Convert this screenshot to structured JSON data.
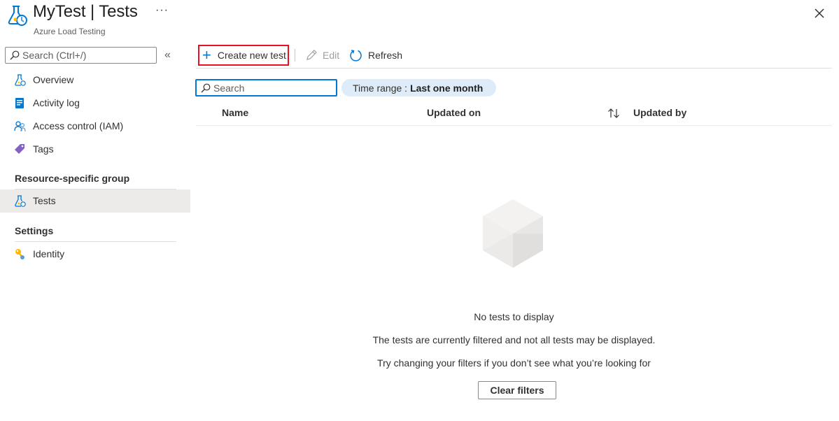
{
  "header": {
    "title": "MyTest | Tests",
    "subtitle": "Azure Load Testing",
    "more_label": "···",
    "app_icon": "load-testing-flask-icon",
    "close_icon": "close-icon"
  },
  "sidebar": {
    "search_placeholder": "Search (Ctrl+/)",
    "collapse_label": "«",
    "items": [
      {
        "label": "Overview",
        "icon": "flask-icon"
      },
      {
        "label": "Activity log",
        "icon": "activity-log-icon"
      },
      {
        "label": "Access control (IAM)",
        "icon": "people-icon"
      },
      {
        "label": "Tags",
        "icon": "tag-icon"
      }
    ],
    "groups": [
      {
        "label": "Resource-specific group",
        "items": [
          {
            "label": "Tests",
            "icon": "flask-icon",
            "selected": true
          }
        ]
      },
      {
        "label": "Settings",
        "items": [
          {
            "label": "Identity",
            "icon": "key-icon"
          }
        ]
      }
    ]
  },
  "toolbar": {
    "create_label": "Create new test",
    "edit_label": "Edit",
    "refresh_label": "Refresh"
  },
  "filters": {
    "search_placeholder": "Search",
    "time_range_key": "Time range :",
    "time_range_value": "Last one month"
  },
  "table": {
    "columns": [
      "Name",
      "Updated on",
      "Updated by"
    ],
    "rows": []
  },
  "empty_state": {
    "title": "No tests to display",
    "line1": "The tests are currently filtered and not all tests may be displayed.",
    "line2": "Try changing your filters if you don’t see what you’re looking for",
    "clear_button": "Clear filters"
  },
  "colors": {
    "accent": "#0078d4",
    "highlight_border": "#e81123",
    "selected_bg": "#edebe9",
    "pill_bg": "#deecf9"
  }
}
